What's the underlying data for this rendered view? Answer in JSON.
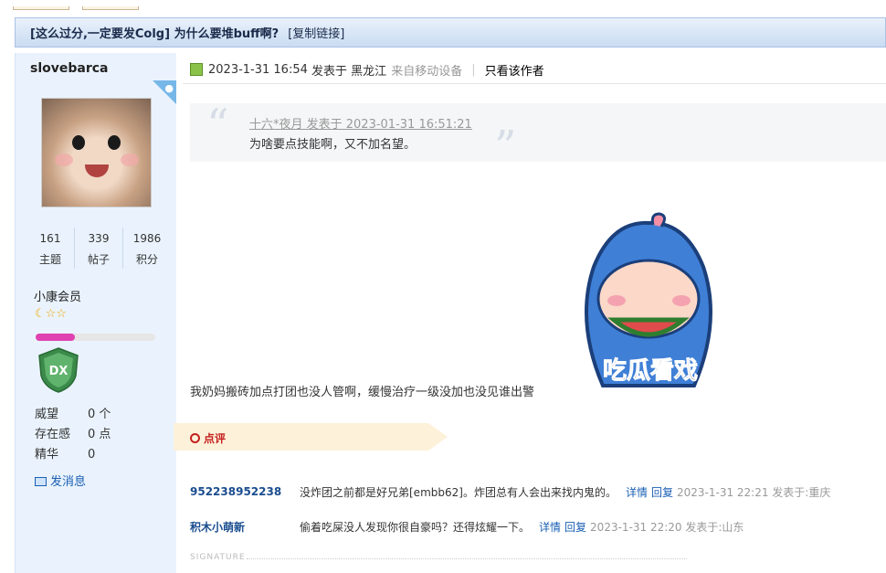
{
  "thread": {
    "title": "[这么过分,一定要发Colg] 为什么要堆buff啊?",
    "copy_link": "[复制链接]"
  },
  "author": {
    "username": "slovebarca",
    "stats": [
      {
        "num": "161",
        "label": "主题"
      },
      {
        "num": "339",
        "label": "帖子"
      },
      {
        "num": "1986",
        "label": "积分"
      }
    ],
    "rank": "小康会员",
    "stars": "☾☆☆",
    "progress": 0.33,
    "info": [
      {
        "label": "威望",
        "value": "0 个"
      },
      {
        "label": "存在感",
        "value": "0 点"
      },
      {
        "label": "精华",
        "value": "0"
      }
    ],
    "send_message": "发消息"
  },
  "post": {
    "date": "2023-1-31 16:54",
    "posted_at": "发表于",
    "location": "黑龙江",
    "from_mobile": "来自移动设备",
    "only_author": "只看该作者",
    "quote_author": "十六*夜月 发表于 2023-01-31 16:51:21",
    "quote_text": "为啥要点技能啊，又不加名望。",
    "body": "我奶妈搬砖加点打团也没人管啊，缓慢治疗一级没加也没见谁出警",
    "sticker_text": "吃瓜看戏"
  },
  "comments_header": "点评",
  "comments": [
    {
      "user": "952238952238",
      "text": "没炸团之前都是好兄弟[embb62]。炸团总有人会出来找内鬼的。",
      "detail": "详情",
      "reply": "回复",
      "time": "2023-1-31 22:21 发表于:重庆"
    },
    {
      "user": "积木小萌新",
      "text": "偷着吃屎没人发现你很自豪吗？还得炫耀一下。",
      "detail": "详情",
      "reply": "回复",
      "time": "2023-1-31 22:20 发表于:山东"
    }
  ],
  "signature_label": "SIGNATURE",
  "colors": {
    "title_bg": "#c9dcf2",
    "sidebar_bg": "#eaf3fd",
    "link": "#1a5fb4",
    "accent_red": "#c4211e"
  }
}
